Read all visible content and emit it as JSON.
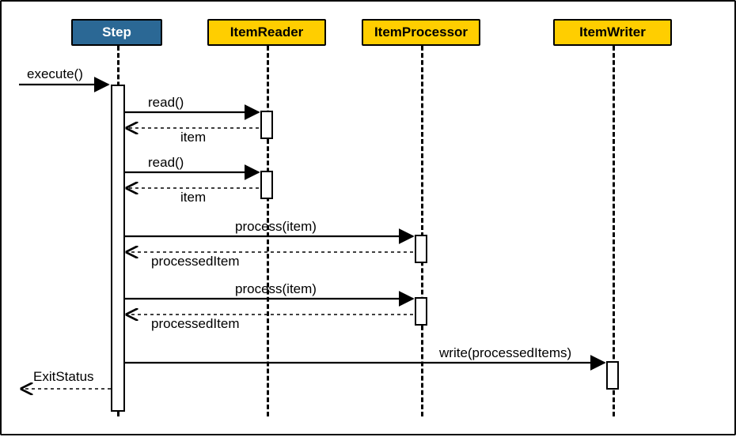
{
  "type": "sequence-diagram",
  "participants": {
    "step": {
      "label": "Step"
    },
    "reader": {
      "label": "ItemReader"
    },
    "processor": {
      "label": "ItemProcessor"
    },
    "writer": {
      "label": "ItemWriter"
    }
  },
  "externalCall": {
    "label": "execute()"
  },
  "exitLabel": {
    "label": "ExitStatus"
  },
  "messages": {
    "read1": {
      "call": "read()",
      "return": "item"
    },
    "read2": {
      "call": "read()",
      "return": "item"
    },
    "proc1": {
      "call": "process(item)",
      "return": "processedItem"
    },
    "proc2": {
      "call": "process(item)",
      "return": "processedItem"
    },
    "write": {
      "call": "write(processedItems)"
    }
  }
}
